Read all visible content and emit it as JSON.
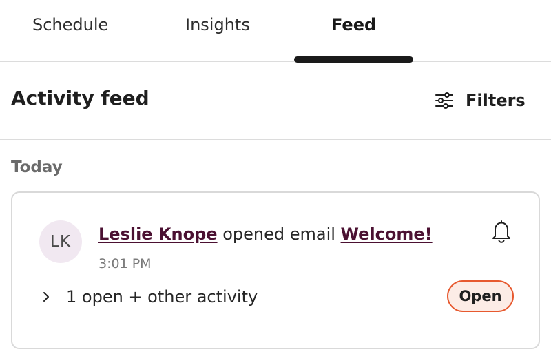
{
  "tabs": [
    {
      "label": "Schedule",
      "active": false
    },
    {
      "label": "Insights",
      "active": false
    },
    {
      "label": "Feed",
      "active": true
    }
  ],
  "header": {
    "title": "Activity feed",
    "filters_label": "Filters",
    "filters_icon": "sliders-icon"
  },
  "section": {
    "label": "Today"
  },
  "activity": {
    "avatar_initials": "LK",
    "contact_name": "Leslie Knope",
    "action_text": " opened email ",
    "email_name": "Welcome!",
    "time": "3:01 PM",
    "bell_icon": "bell-icon",
    "expand_icon": "chevron-right-icon",
    "expand_label": "1 open + other activity",
    "status": "Open"
  },
  "colors": {
    "link": "#4b1132",
    "badge_border": "#e7592f",
    "badge_bg": "#fcece6",
    "avatar_bg": "#f1e8f1"
  }
}
